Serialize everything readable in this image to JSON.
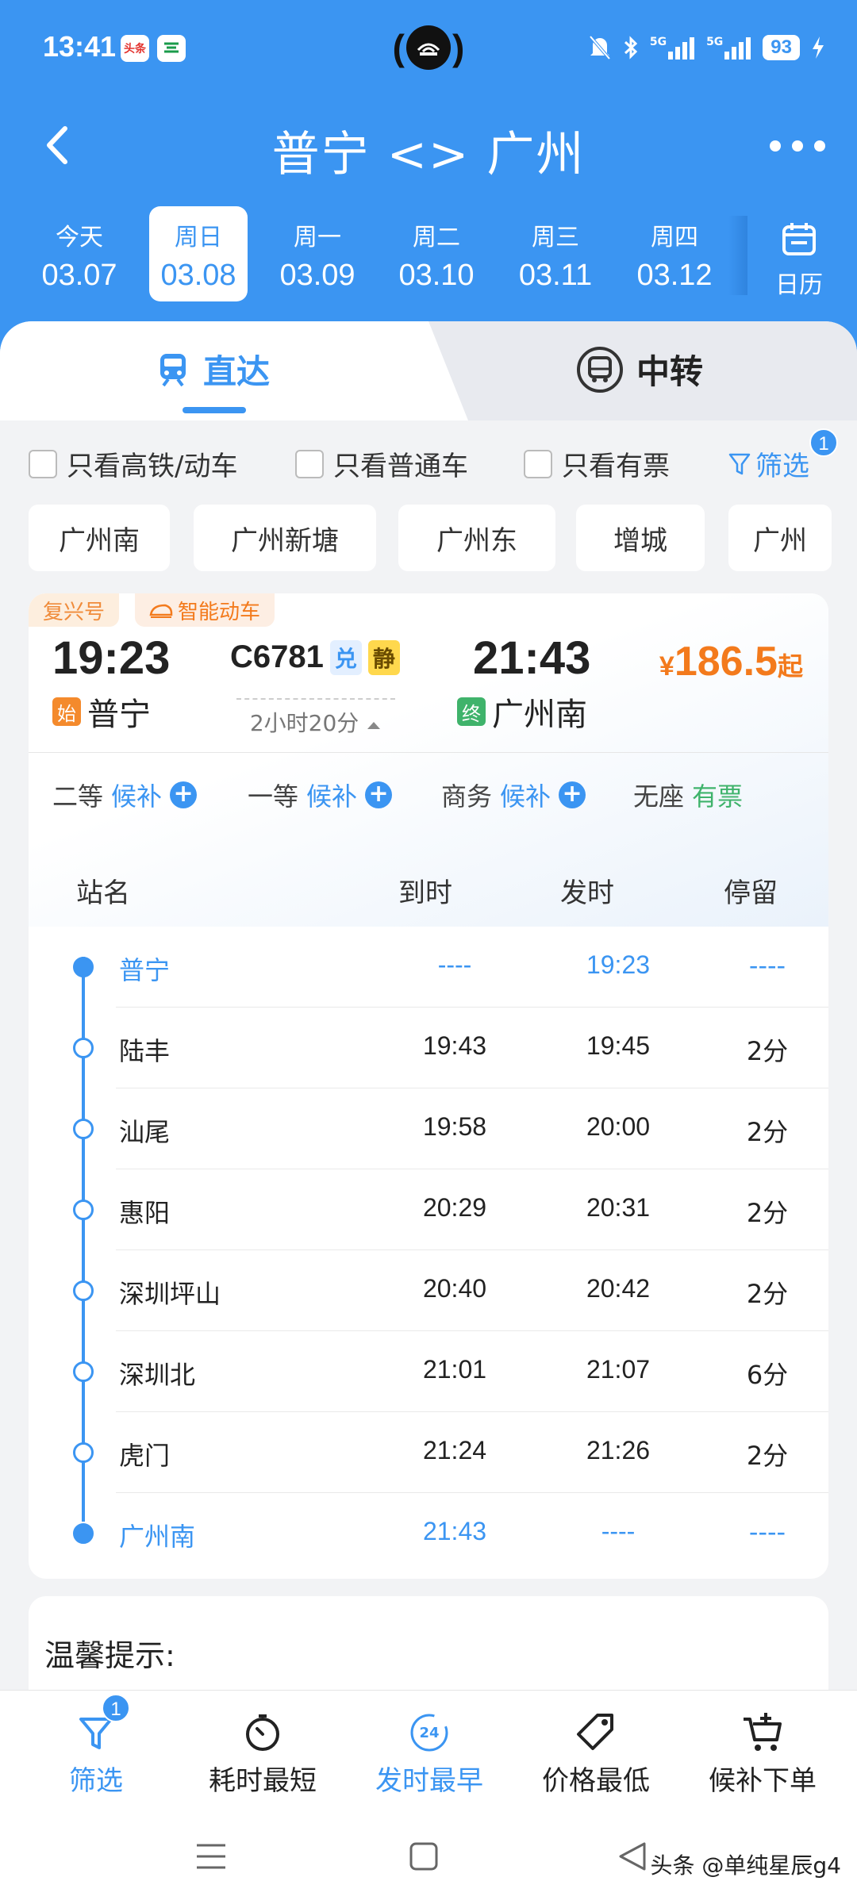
{
  "status_bar": {
    "time": "13:41",
    "app1": "头条",
    "battery": "93",
    "net1": "5G",
    "net2": "5G"
  },
  "header": {
    "title": "普宁 <> 广州"
  },
  "dates": [
    {
      "weekday": "今天",
      "date": "03.07"
    },
    {
      "weekday": "周日",
      "date": "03.08"
    },
    {
      "weekday": "周一",
      "date": "03.09"
    },
    {
      "weekday": "周二",
      "date": "03.10"
    },
    {
      "weekday": "周三",
      "date": "03.11"
    },
    {
      "weekday": "周四",
      "date": "03.12"
    }
  ],
  "calendar_label": "日历",
  "tabs": {
    "direct": "直达",
    "transfer": "中转"
  },
  "filters": {
    "only_highspeed": "只看高铁/动车",
    "only_normal": "只看普通车",
    "only_available": "只看有票",
    "filter_label": "筛选",
    "filter_badge": "1"
  },
  "station_chips": [
    "广州南",
    "广州新塘",
    "广州东",
    "增城",
    "广州"
  ],
  "train": {
    "tag1": "复兴号",
    "tag2": "智能动车",
    "dep_time": "19:23",
    "arr_time": "21:43",
    "number": "C6781",
    "pill1": "兑",
    "pill2": "静",
    "duration": "2小时20分",
    "dep_station": "普宁",
    "arr_station": "广州南",
    "dep_mark": "始",
    "arr_mark": "终",
    "price_symbol": "¥",
    "price": "186.5",
    "price_suffix": "起",
    "seats": [
      {
        "class": "二等",
        "status": "候补"
      },
      {
        "class": "一等",
        "status": "候补"
      },
      {
        "class": "商务",
        "status": "候补"
      },
      {
        "class": "无座",
        "status": "有票"
      }
    ]
  },
  "stop_header": {
    "name": "站名",
    "arrive": "到时",
    "depart": "发时",
    "stay": "停留"
  },
  "stops": [
    {
      "name": "普宁",
      "arrive": "----",
      "depart": "19:23",
      "stay": "----"
    },
    {
      "name": "陆丰",
      "arrive": "19:43",
      "depart": "19:45",
      "stay": "2分"
    },
    {
      "name": "汕尾",
      "arrive": "19:58",
      "depart": "20:00",
      "stay": "2分"
    },
    {
      "name": "惠阳",
      "arrive": "20:29",
      "depart": "20:31",
      "stay": "2分"
    },
    {
      "name": "深圳坪山",
      "arrive": "20:40",
      "depart": "20:42",
      "stay": "2分"
    },
    {
      "name": "深圳北",
      "arrive": "21:01",
      "depart": "21:07",
      "stay": "6分"
    },
    {
      "name": "虎门",
      "arrive": "21:24",
      "depart": "21:26",
      "stay": "2分"
    },
    {
      "name": "广州南",
      "arrive": "21:43",
      "depart": "----",
      "stay": "----"
    }
  ],
  "tips_title": "温馨提示:",
  "bottom_bar": {
    "filter": "筛选",
    "filter_badge": "1",
    "shortest": "耗时最短",
    "earliest": "发时最早",
    "earliest_icon_text": "24",
    "cheapest": "价格最低",
    "waitlist": "候补下单"
  },
  "watermark": "头条 @单纯星辰g4",
  "colors": {
    "primary": "#3b95f2",
    "price": "#f37a1c",
    "green": "#3fb36b"
  }
}
